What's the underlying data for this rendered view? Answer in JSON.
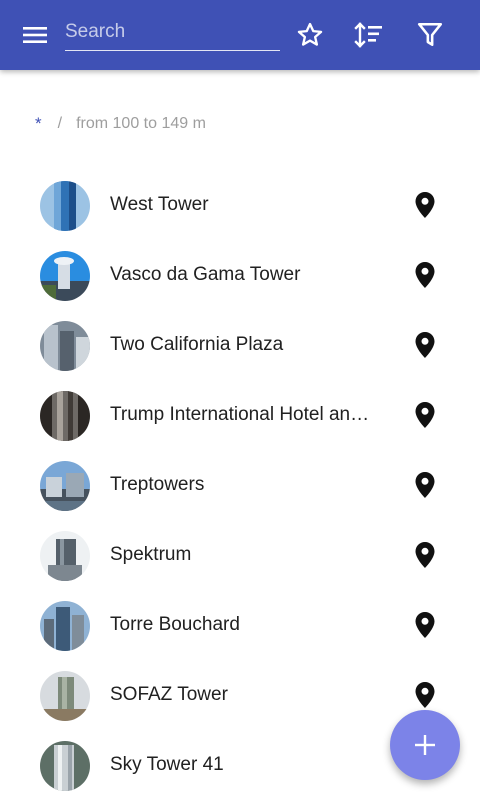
{
  "colors": {
    "appbar": "#3f51b5",
    "accent": "#3f51b5",
    "fab": "#7c83e8",
    "text": "#212121",
    "muted": "#9e9e9e"
  },
  "appbar": {
    "menu_icon": "menu-icon",
    "search_placeholder": "Search",
    "actions": [
      {
        "icon": "star-outline-icon"
      },
      {
        "icon": "sort-icon"
      },
      {
        "icon": "filter-icon"
      }
    ]
  },
  "breadcrumb": {
    "root": "*",
    "separator": "/",
    "current": "from 100 to 149 m"
  },
  "items": [
    {
      "name": "West Tower"
    },
    {
      "name": "Vasco da Gama Tower"
    },
    {
      "name": "Two California Plaza"
    },
    {
      "name": "Trump International Hotel and Tower"
    },
    {
      "name": "Treptowers"
    },
    {
      "name": "Spektrum"
    },
    {
      "name": "Torre Bouchard"
    },
    {
      "name": "SOFAZ Tower"
    },
    {
      "name": "Sky Tower 41"
    }
  ],
  "fab": {
    "icon": "plus-icon"
  }
}
